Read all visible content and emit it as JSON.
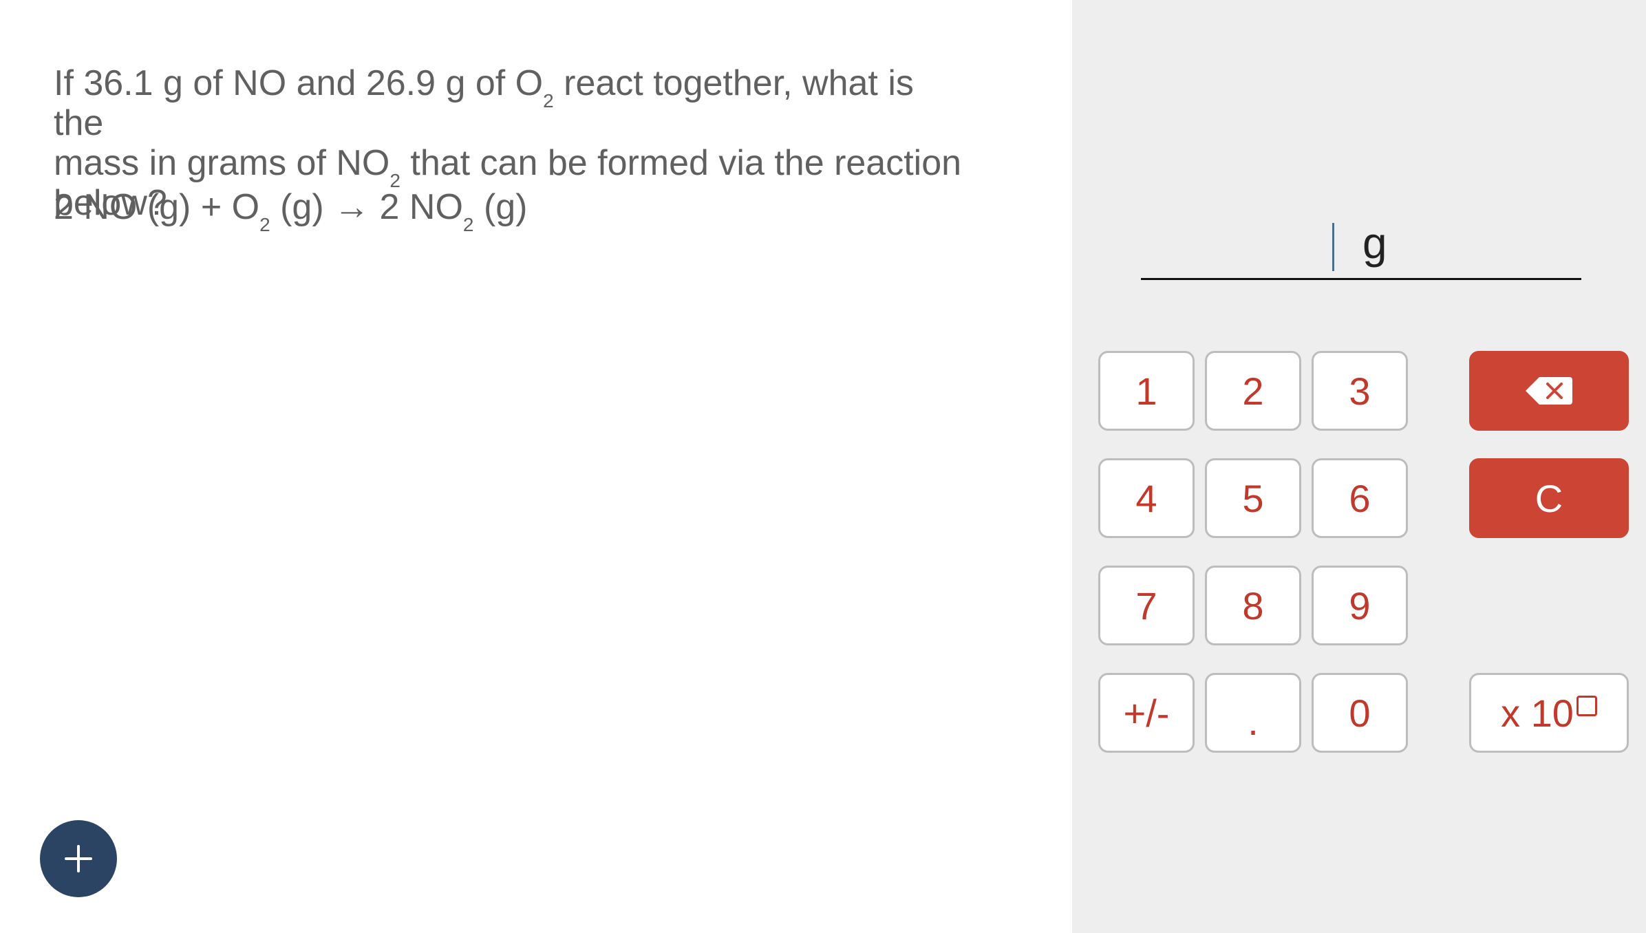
{
  "question": {
    "line1_a": "If 36.1 g of NO and 26.9 g of O",
    "line1_sub": "2",
    "line1_b": " react together, what is the",
    "line2_a": "mass in grams of NO",
    "line2_sub": "2",
    "line2_b": " that can be formed via the reaction",
    "line3": "below?"
  },
  "equation": {
    "part1": "2 NO (g) + O",
    "sub1": "2",
    "part2": " (g) → 2 NO",
    "sub2": "2",
    "part3": " (g)"
  },
  "answer": {
    "value": "",
    "unit": "g"
  },
  "keypad": {
    "digits": [
      "1",
      "2",
      "3",
      "4",
      "5",
      "6",
      "7",
      "8",
      "9",
      "0"
    ],
    "sign": "+/-",
    "decimal": ".",
    "clear": "C",
    "sci_prefix": "x 10"
  },
  "icons": {
    "backspace": "backspace-icon",
    "add": "plus-icon",
    "exponent_box": "square-icon"
  },
  "colors": {
    "accent": "#cc4433",
    "key_text": "#c0392b",
    "fab": "#2b4464",
    "panel": "#eeeeee",
    "question_text": "#606060"
  }
}
